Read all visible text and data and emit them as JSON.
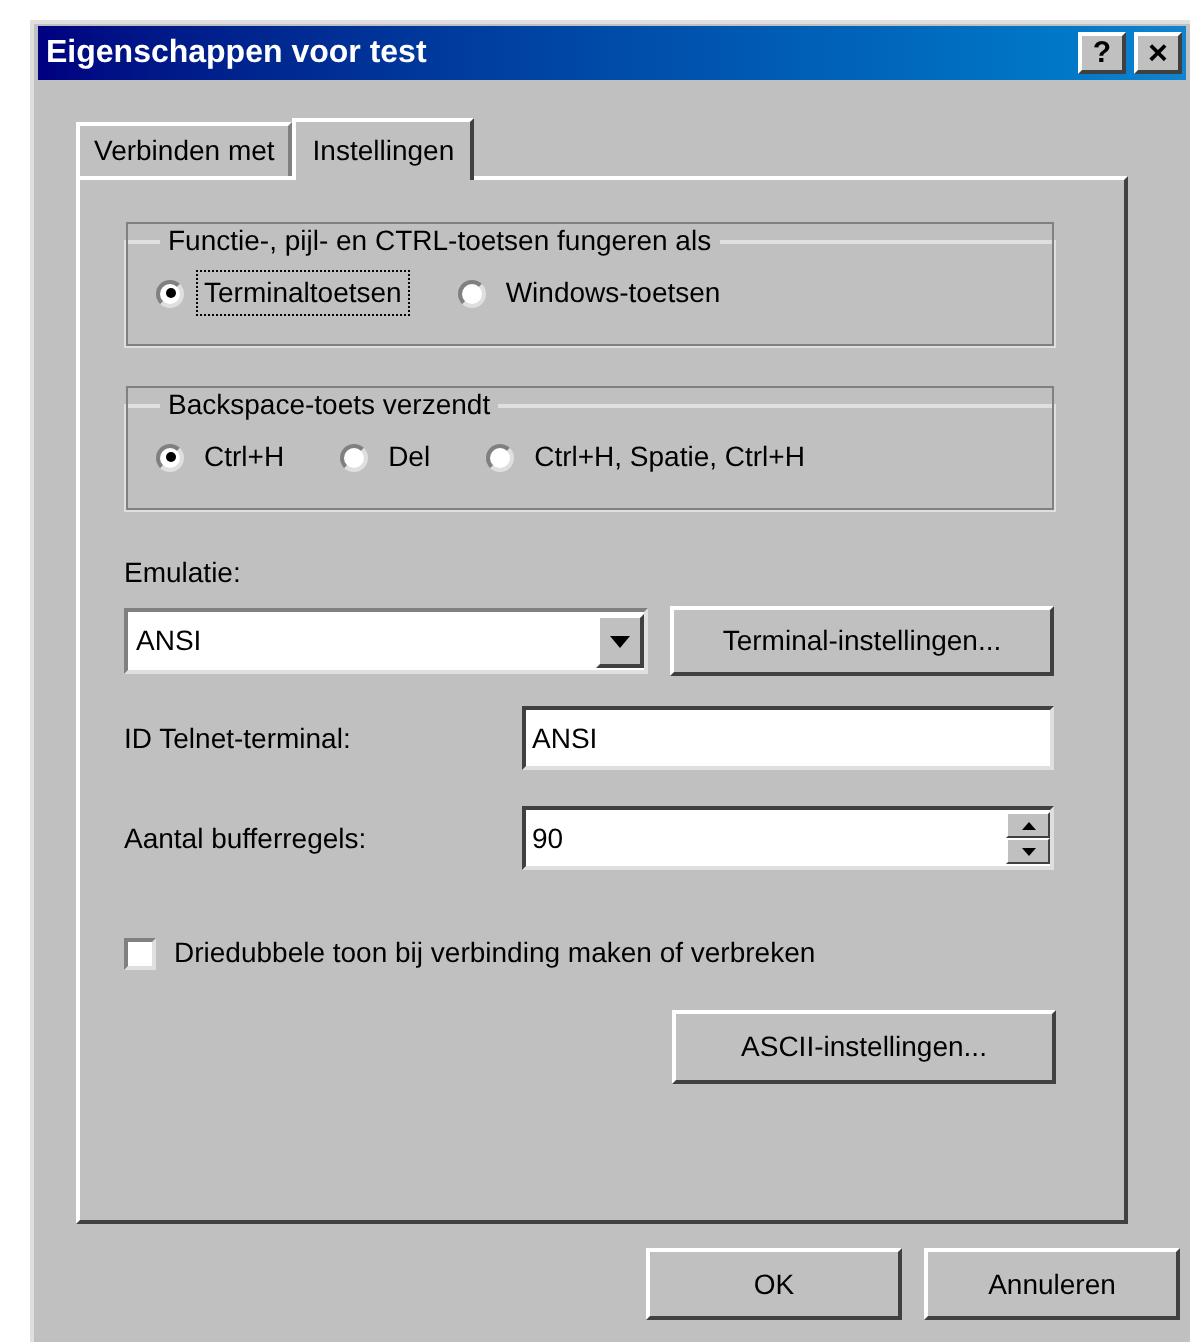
{
  "window": {
    "title": "Eigenschappen voor test",
    "help_button": "?",
    "close_button": "×"
  },
  "tabs": [
    {
      "label": "Verbinden met",
      "selected": false
    },
    {
      "label": "Instellingen",
      "selected": true
    }
  ],
  "groups": [
    {
      "title": "Functie-, pijl- en CTRL-toetsen fungeren als",
      "options": [
        {
          "label": "Terminaltoetsen",
          "selected": true,
          "focused": true
        },
        {
          "label": "Windows-toetsen",
          "selected": false,
          "focused": false
        }
      ]
    },
    {
      "title": "Backspace-toets verzendt",
      "options": [
        {
          "label": "Ctrl+H",
          "selected": true,
          "focused": false
        },
        {
          "label": "Del",
          "selected": false,
          "focused": false
        },
        {
          "label": "Ctrl+H, Spatie, Ctrl+H",
          "selected": false,
          "focused": false
        }
      ]
    }
  ],
  "emulation": {
    "label": "Emulatie:",
    "value": "ANSI",
    "button": "Terminal-instellingen..."
  },
  "terminal_id": {
    "label": "ID Telnet-terminal:",
    "value": "ANSI"
  },
  "buffer_lines": {
    "label": "Aantal bufferregels:",
    "value": "90"
  },
  "triple_tone": {
    "label": "Driedubbele toon bij verbinding maken of verbreken",
    "checked": false
  },
  "ascii_button": "ASCII-instellingen...",
  "buttons": [
    "OK",
    "Annuleren"
  ]
}
